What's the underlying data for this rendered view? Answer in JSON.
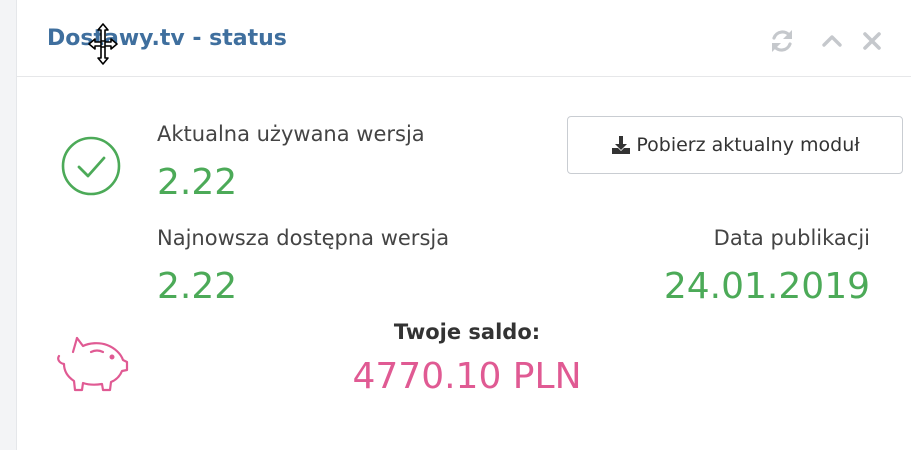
{
  "header": {
    "title": "Dostawy.tv - status",
    "icons": [
      "refresh-icon",
      "chevron-up-icon",
      "close-icon"
    ]
  },
  "status": {
    "current_label": "Aktualna używana wersja",
    "current_version": "2.22",
    "latest_label": "Najnowsza dostępna wersja",
    "latest_version": "2.22",
    "publication_label": "Data publikacji",
    "publication_date": "24.01.2019",
    "icon": "check-circle-icon"
  },
  "download_button": {
    "label": "Pobierz aktualny moduł",
    "icon": "download-icon"
  },
  "balance": {
    "label": "Twoje saldo:",
    "value": "4770.10 PLN",
    "icon": "piggy-bank-icon"
  },
  "colors": {
    "title": "#3f6f9e",
    "green": "#4caa58",
    "pink": "#e05a93",
    "header_icons": "#c5c8cc"
  }
}
